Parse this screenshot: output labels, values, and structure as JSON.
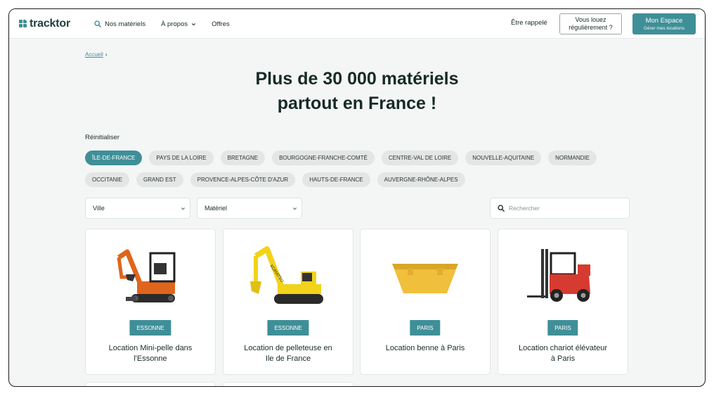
{
  "header": {
    "logo_text": "tracktor",
    "nav": [
      {
        "label": "Nos matériels",
        "icon": "search-icon"
      },
      {
        "label": "À propos",
        "icon": "chevron-down-icon"
      },
      {
        "label": "Offres"
      }
    ],
    "callback_label": "Être rappelé",
    "rent_regularly": {
      "line1": "Vous louez",
      "line2": "régulièrement ?"
    },
    "my_space": {
      "label": "Mon Espace",
      "sublabel": "Gérer mes locations"
    }
  },
  "breadcrumb": {
    "home": "Accueil",
    "separator": "›"
  },
  "hero": {
    "line1": "Plus de 30 000 matériels",
    "line2": "partout en France !"
  },
  "filters": {
    "reset_label": "Réinitialiser",
    "regions_row1": [
      "ÎLE-DE-FRANCE",
      "PAYS DE LA LOIRE",
      "BRETAGNE",
      "BOURGOGNE-FRANCHE-COMTÉ",
      "CENTRE-VAL DE LOIRE",
      "NOUVELLE-AQUITAINE",
      "NORMANDIE"
    ],
    "regions_row2": [
      "OCCITANIE",
      "GRAND EST",
      "PROVENCE-ALPES-CÔTE D'AZUR",
      "HAUTS-DE-FRANCE",
      "AUVERGNE-RHÔNE-ALPES"
    ],
    "active_region": "ÎLE-DE-FRANCE",
    "city_select": "Ville",
    "material_select": "Matériel",
    "search_placeholder": "Rechercher"
  },
  "cards": [
    {
      "badge": "ESSONNE",
      "title_line1": "Location Mini-pelle dans",
      "title_line2": "l'Essonne",
      "image": "mini-excavator"
    },
    {
      "badge": "ESSONNE",
      "title_line1": "Location de pelleteuse en",
      "title_line2": "Ile de France",
      "image": "excavator"
    },
    {
      "badge": "PARIS",
      "title_line1": "Location benne à Paris",
      "title_line2": "",
      "image": "skip-container"
    },
    {
      "badge": "PARIS",
      "title_line1": "Location chariot élévateur",
      "title_line2": "à Paris",
      "image": "forklift"
    }
  ],
  "colors": {
    "accent": "#3f8f98",
    "dark_text": "#172a27",
    "background": "#f4f6f5",
    "chip": "#e4e6e5"
  }
}
